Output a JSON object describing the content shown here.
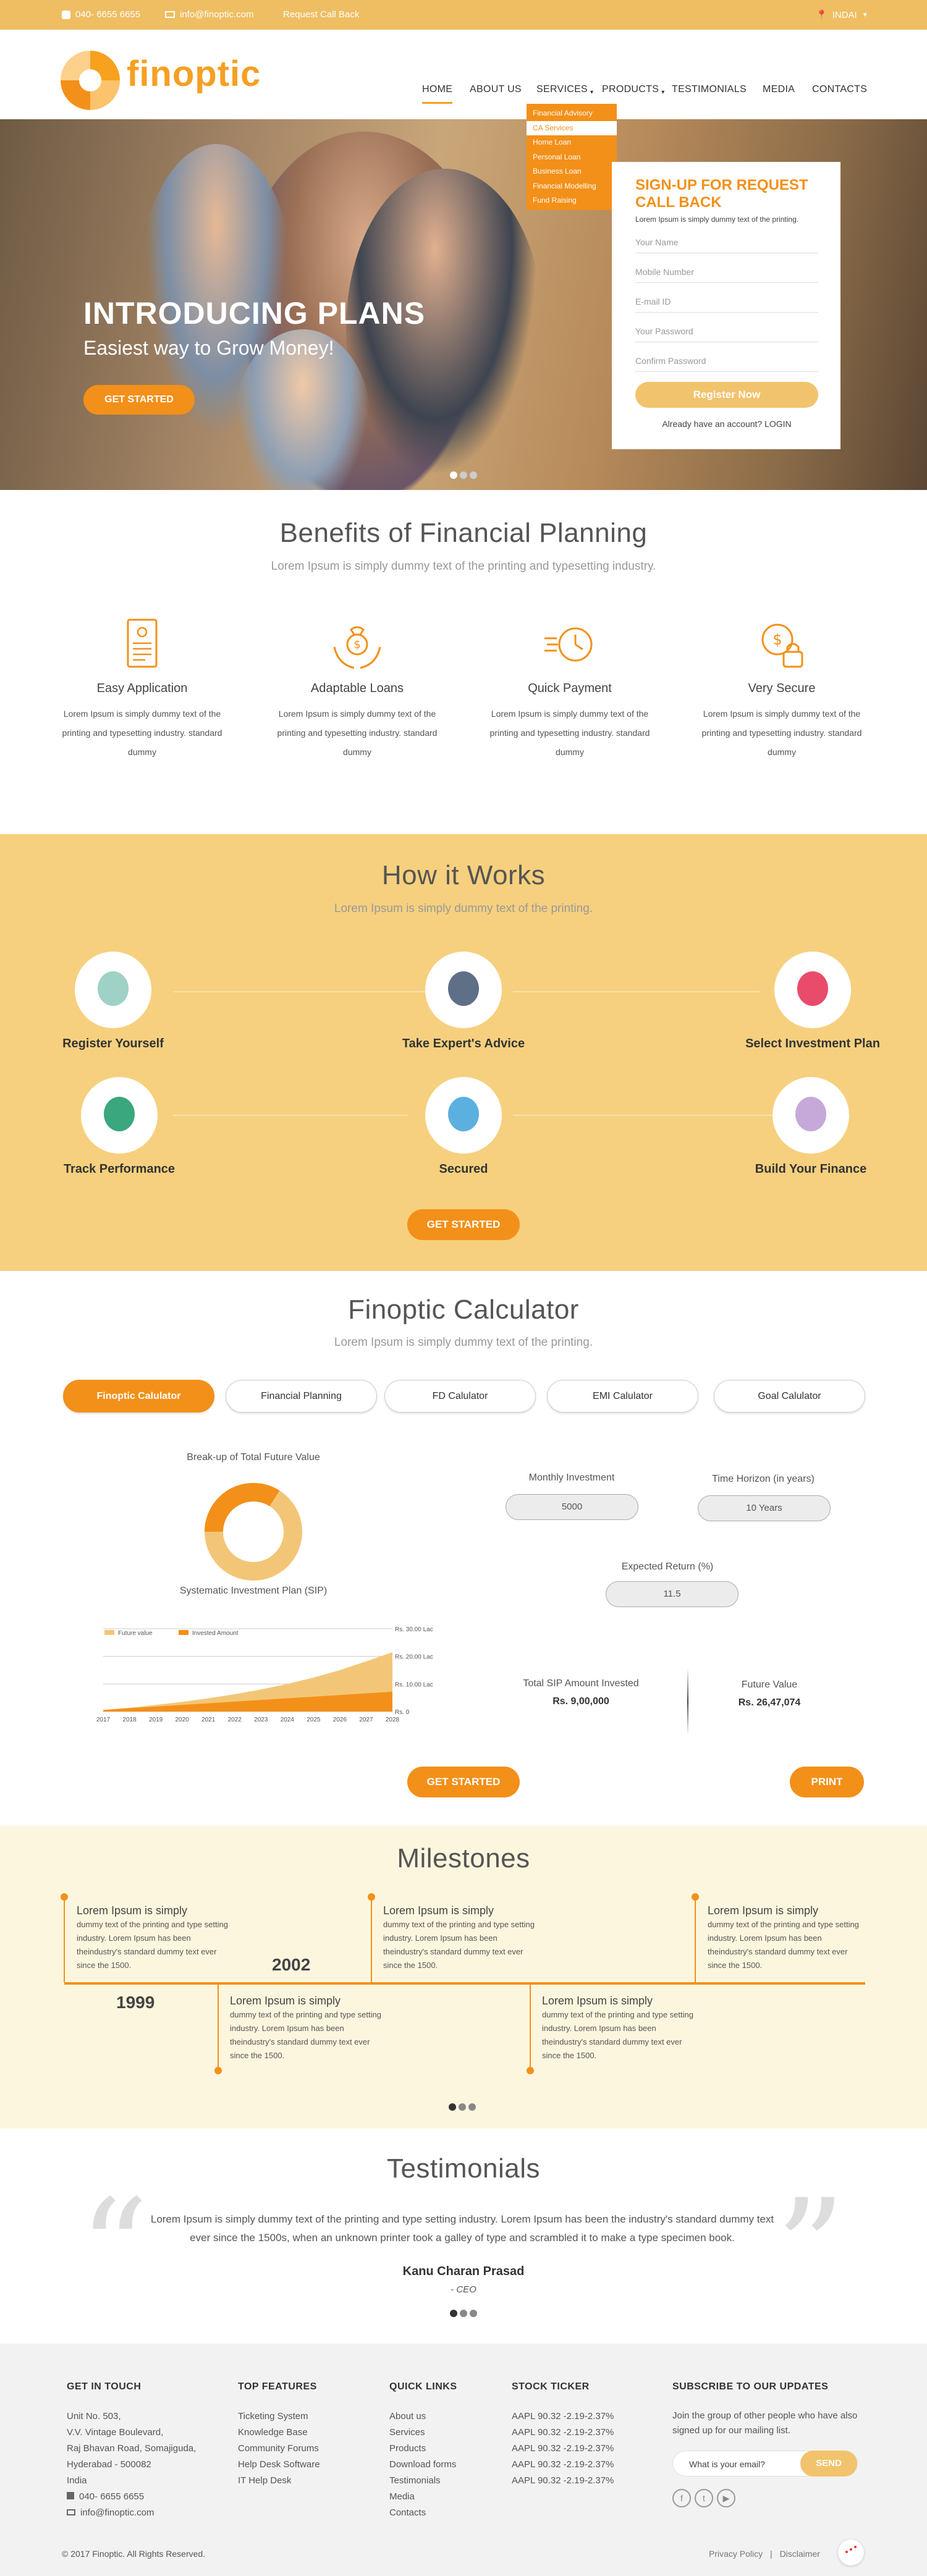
{
  "topbar": {
    "phone": "040- 6655 6655",
    "email": "info@finoptic.com",
    "callback": "Request Call Back",
    "country": "INDAI"
  },
  "brand": {
    "name": "finoptic"
  },
  "nav": {
    "home": "HOME",
    "about": "ABOUT US",
    "services": "SERVICES",
    "products": "PRODUCTS",
    "testimonials": "TESTIMONIALS",
    "media": "MEDIA",
    "contacts": "CONTACTS"
  },
  "dropdown": [
    "Financial Advisory",
    "CA Services",
    "Home Loan",
    "Personal Loan",
    "Business Loan",
    "Financial Modelling",
    "Fund Raising"
  ],
  "hero": {
    "title": "INTRODUCING PLANS",
    "subtitle": "Easiest way to Grow Money!",
    "cta": "GET STARTED"
  },
  "signup": {
    "title": "SIGN-UP FOR REQUEST CALL BACK",
    "text": "Lorem Ipsum is simply dummy text of the printing.",
    "name": "Your Name",
    "mobile": "Mobile Number",
    "email": "E-mail ID",
    "password": "Your Password",
    "confirm": "Confirm Password",
    "button": "Register Now",
    "login": "Already have an account? LOGIN"
  },
  "benefits": {
    "title": "Benefits of Financial Planning",
    "lead": "Lorem Ipsum is simply dummy text of the printing and typesetting industry.",
    "items": [
      {
        "title": "Easy Application",
        "desc": "Lorem Ipsum is simply dummy text of the printing and typesetting industry. standard dummy",
        "icon": "document-icon"
      },
      {
        "title": "Adaptable Loans",
        "desc": "Lorem Ipsum is simply dummy text of the printing and typesetting industry. standard dummy",
        "icon": "money-bag-hands-icon"
      },
      {
        "title": "Quick Payment",
        "desc": "Lorem Ipsum is simply dummy text of the printing and typesetting industry. standard dummy",
        "icon": "clock-speed-icon"
      },
      {
        "title": "Very Secure",
        "desc": "Lorem Ipsum is simply dummy text of the printing and typesetting industry. standard dummy",
        "icon": "dollar-lock-icon"
      }
    ]
  },
  "how": {
    "title": "How it Works",
    "lead": "Lorem Ipsum is simply dummy text of the printing.",
    "steps": [
      "Register Yourself",
      "Take Expert's Advice",
      "Select Investment Plan",
      "Track Performance",
      "Secured",
      "Build Your Finance"
    ],
    "cta": "GET STARTED"
  },
  "calc": {
    "title": "Finoptic Calculator",
    "lead": "Lorem Ipsum is simply dummy text of the printing.",
    "tabs": [
      "Finoptic Calulator",
      "Financial Planning",
      "FD Calulator",
      "EMI Calulator",
      "Goal Calulator"
    ],
    "breakup": "Break-up of Total Future Value",
    "sip_title": "Systematic Investment Plan (SIP)",
    "monthly_label": "Monthly Investment",
    "monthly_value": "5000",
    "horizon_label": "Time Horizon (in years)",
    "horizon_value": "10 Years",
    "return_label": "Expected Return (%)",
    "return_value": "11.5",
    "invested_label": "Total SIP Amount Invested",
    "invested_value": "Rs. 9,00,000",
    "future_label": "Future Value",
    "future_value": "Rs. 26,47,074",
    "cta": "GET STARTED",
    "print": "PRINT",
    "accent": "#f39019",
    "light": "#f3c677"
  },
  "chart_data": {
    "type": "area",
    "x": [
      "2017",
      "2018",
      "2019",
      "2020",
      "2021",
      "2022",
      "2023",
      "2024",
      "2025",
      "2026",
      "2027",
      "2028"
    ],
    "series": [
      {
        "name": "Future value",
        "values": [
          0.6,
          1.4,
          2.4,
          3.5,
          4.8,
          6.3,
          8.0,
          10.0,
          12.3,
          15.0,
          18.2,
          21.5
        ]
      },
      {
        "name": "Invested Amount",
        "values": [
          0.6,
          1.2,
          1.8,
          2.4,
          3.0,
          3.6,
          4.2,
          4.8,
          5.4,
          6.0,
          6.6,
          7.2
        ]
      }
    ],
    "yticks": [
      "Rs. 0",
      "Rs. 10.00 Lac",
      "Rs. 20.00 Lac",
      "Rs. 30.00 Lac"
    ],
    "ylim": [
      0,
      30
    ],
    "donut": {
      "invested": 34,
      "gains": 66
    }
  },
  "milestones": {
    "title": "Milestones",
    "heading": "Lorem Ipsum is simply",
    "body": "dummy text of the printing and type setting industry. Lorem Ipsum has been theindustry's standard dummy text ever since the 1500.",
    "years": [
      "1999",
      "2002"
    ]
  },
  "testimonial": {
    "title": "Testimonials",
    "quote": "Lorem Ipsum is simply dummy text of the printing and type setting industry. Lorem Ipsum has been the industry's standard dummy text ever since the 1500s, when an unknown printer took a galley of type and scrambled it to make a type specimen book.",
    "name": "Kanu Charan Prasad",
    "role": "- CEO"
  },
  "footer": {
    "touch_title": "GET IN TOUCH",
    "address": [
      "Unit No. 503,",
      "V.V. Vintage Boulevard,",
      "Raj Bhavan Road, Somajiguda,",
      "Hyderabad - 500082",
      "India"
    ],
    "phone": "040- 6655 6655",
    "email": "info@finoptic.com",
    "features_title": "TOP FEATURES",
    "features": [
      "Ticketing System",
      "Knowledge Base",
      "Community Forums",
      "Help Desk Software",
      "IT Help Desk"
    ],
    "links_title": "QUICK LINKS",
    "links": [
      "About us",
      "Services",
      "Products",
      "Download forms",
      "Testimonials",
      "Media",
      "Contacts"
    ],
    "ticker_title": "STOCK TICKER",
    "ticker": [
      "AAPL 90.32 -2.19-2.37%",
      "AAPL 90.32 -2.19-2.37%",
      "AAPL 90.32 -2.19-2.37%",
      "AAPL 90.32 -2.19-2.37%",
      "AAPL 90.32 -2.19-2.37%"
    ],
    "subscribe_title": "SUBSCRIBE TO OUR UPDATES",
    "subscribe_text": "Join the group of other people who have also signed up for our mailing list.",
    "email_placeholder": "What is your email?",
    "send": "SEND",
    "copyright": "© 2017 Finoptic. All Rights Reserved.",
    "privacy": "Privacy Policy",
    "disclaimer": "Disclaimer",
    "sep": "|"
  }
}
